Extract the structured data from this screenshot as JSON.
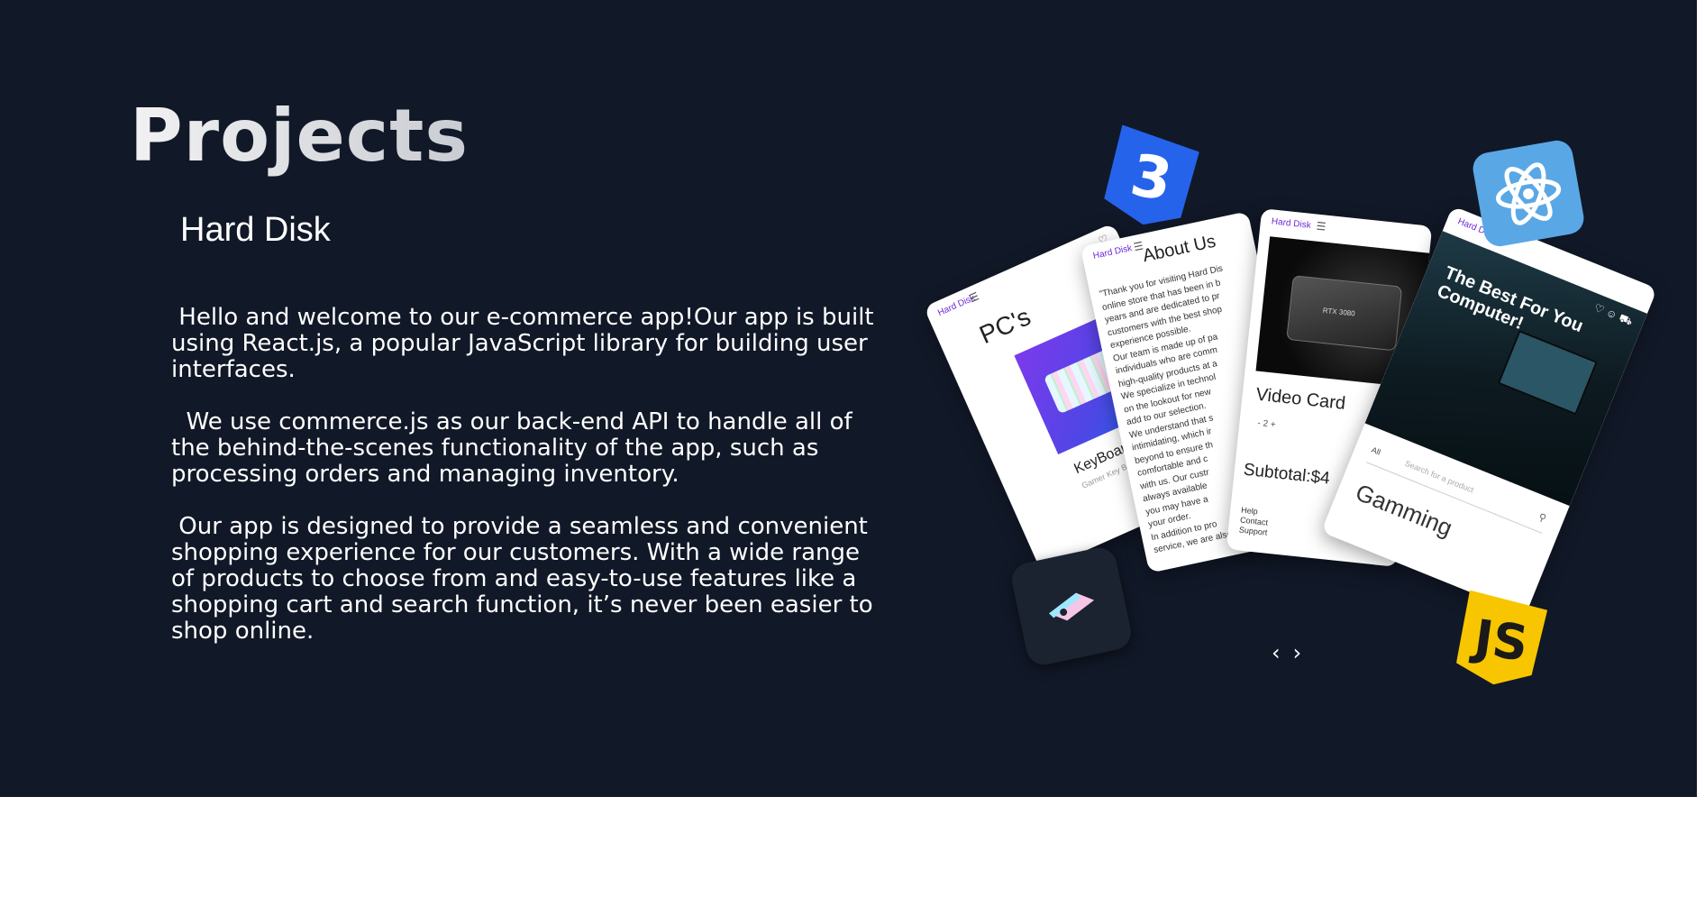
{
  "section": {
    "title": "Projects"
  },
  "project": {
    "name": "Hard Disk",
    "paragraphs": [
      " Hello and welcome to our e-commerce app!Our app is built using React.js, a popular JavaScript library for building user interfaces.",
      "  We use commerce.js as our back-end API to handle all of the behind-the-scenes functionality of the app, such as processing orders and managing inventory.",
      " Our app is designed to provide a seamless and convenient shopping experience for our customers. With a wide range of products to choose from and easy-to-use features like a shopping cart and search function, it’s never been easier to shop online."
    ]
  },
  "showcase": {
    "brand": "Hard Disk",
    "pcs_card": {
      "heading": "PC's",
      "product_label": "KeyBoard",
      "product_sub": "Gamer Key Board"
    },
    "about_card": {
      "heading": "About Us",
      "text": "\"Thank you for visiting Hard Dis\nonline store that has been in b\nyears and are dedicated to pr\ncustomers with the best shop\nexperience possible.\nOur team is made up of pa\nindividuals who are comm\nhigh-quality products at a\nWe specialize in technol\non the lookout for new\nadd to our selection.\nWe understand that s\nintimidating, which ir\nbeyond to ensure th\ncomfortable and c\nwith us. Our custr\nalways available\nyou may have a\nyour order.\nIn addition to pro\nservice, we are also dedica"
    },
    "video_card": {
      "gpu_label": "RTX 3080",
      "title": "Video Card",
      "qty": "-   2   +",
      "subtotal": "Subtotal:$4",
      "links": "Help\nContact\nSupport"
    },
    "gaming_card": {
      "hero_text": "The Best For You Computer!",
      "filter_label": "All",
      "search_placeholder": "Search for a product",
      "category": "Gamming"
    },
    "tech_icons": [
      "css3-icon",
      "react-icon",
      "javascript-icon",
      "figma-like-icon"
    ],
    "tech_colors": {
      "css": "#2563eb",
      "react": "#5aa7e6",
      "js": "#f7c600"
    }
  },
  "carousel": {
    "prev": "‹",
    "next": "›"
  },
  "colors": {
    "background": "#111827",
    "text": "#ffffff"
  }
}
